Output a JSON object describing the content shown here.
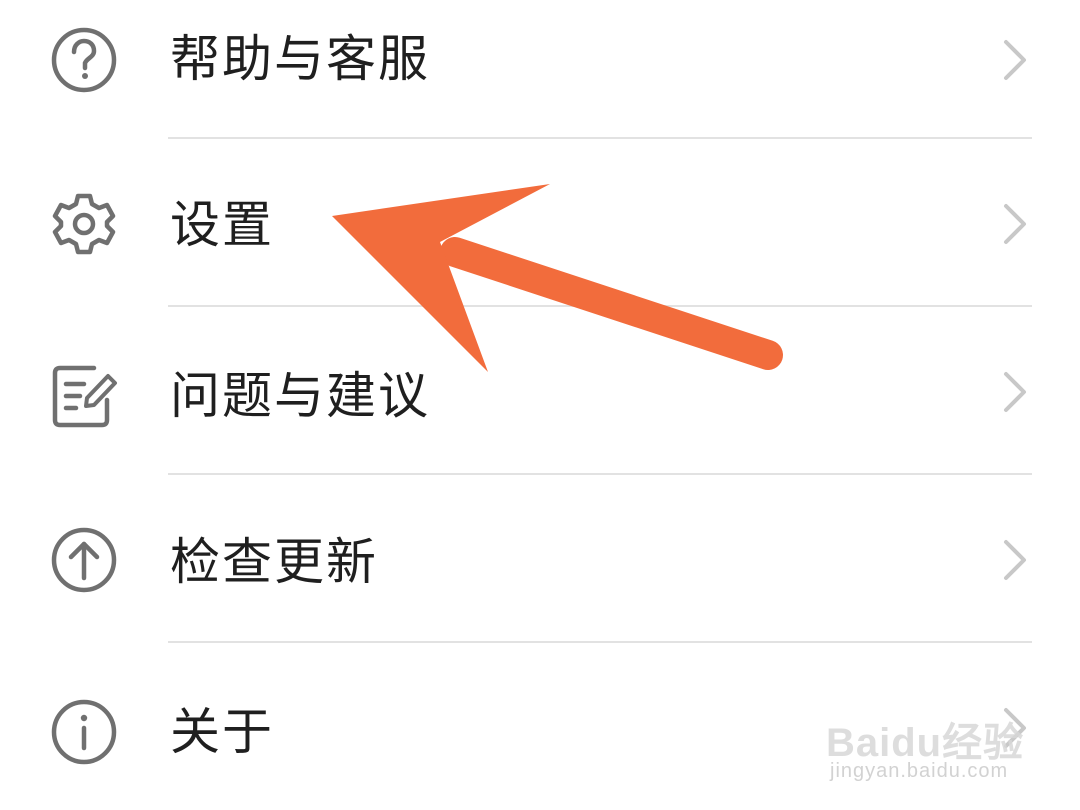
{
  "menu": {
    "items": [
      {
        "label": "帮助与客服",
        "icon": "help-circle-icon"
      },
      {
        "label": "设置",
        "icon": "gear-icon"
      },
      {
        "label": "问题与建议",
        "icon": "feedback-edit-icon"
      },
      {
        "label": "检查更新",
        "icon": "upload-arrow-circle-icon"
      },
      {
        "label": "关于",
        "icon": "info-circle-icon"
      }
    ]
  },
  "annotation": {
    "arrow_color": "#f26c3c",
    "target": "设置"
  },
  "watermark": {
    "brand": "Baidu经验",
    "url": "jingyan.baidu.com"
  },
  "colors": {
    "text": "#1f1f1f",
    "icon": "#707070",
    "chevron": "#c8c8c8",
    "divider": "#e2e2e2"
  }
}
